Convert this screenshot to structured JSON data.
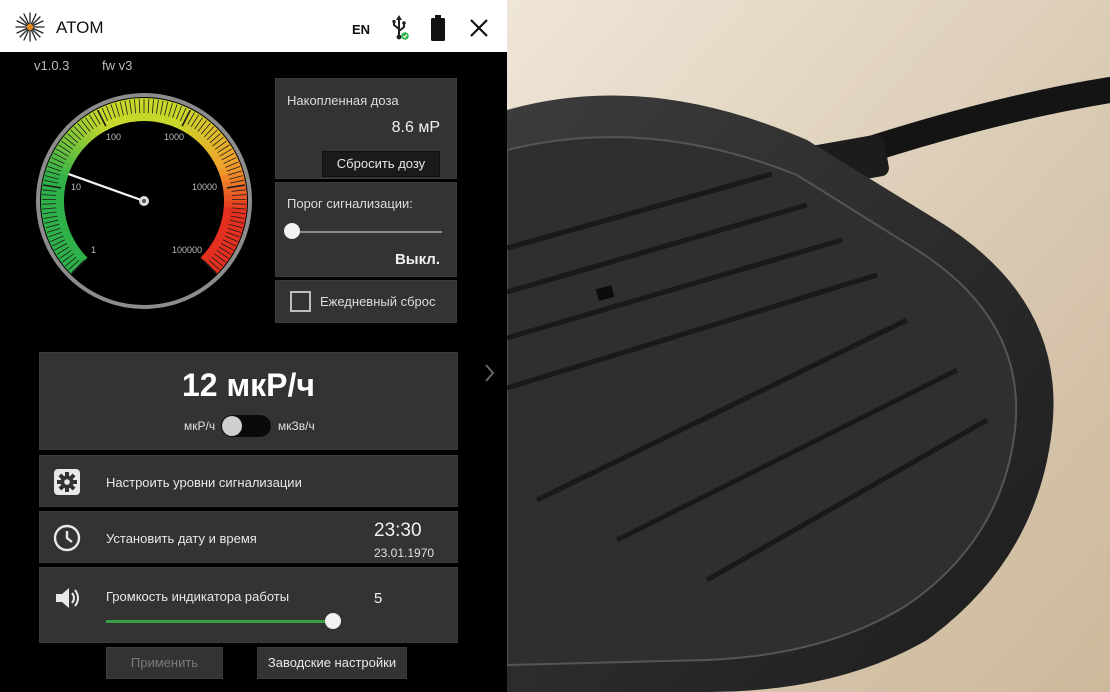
{
  "app": {
    "title": "ATOM",
    "language": "EN",
    "version": "v1.0.3",
    "firmware": "fw v3"
  },
  "icons": {
    "logo": "atom-logo-icon",
    "usb": "usb-connected-icon",
    "battery": "battery-icon",
    "close": "close-icon",
    "settings": "gear-icon",
    "clock": "clock-icon",
    "volume": "speaker-icon",
    "next": "chevron-right-icon"
  },
  "gauge": {
    "labels": [
      "1",
      "10",
      "100",
      "1000",
      "10000",
      "100000"
    ],
    "needle_value": 12,
    "colors": {
      "low": "#2fb14a",
      "mid": "#c8d82a",
      "warn": "#f2a12c",
      "high": "#e53020"
    }
  },
  "dose": {
    "label": "Накопленная доза",
    "value": "8.6 мР",
    "reset_button": "Сбросить дозу"
  },
  "alarm_threshold": {
    "label": "Порог сигнализации:",
    "value": "Выкл.",
    "level": 0
  },
  "daily_reset": {
    "label": "Ежедневный сброс",
    "checked": false
  },
  "rate": {
    "value": "12 мкР/ч",
    "unit_left": "мкР/ч",
    "unit_right": "мкЗв/ч",
    "toggle_on": false
  },
  "settings": {
    "alarm_levels_label": "Настроить уровни сигнализации",
    "datetime_label": "Установить дату и время",
    "time": "23:30",
    "date": "23.01.1970",
    "volume_label": "Громкость индикатора работы",
    "volume_value": "5",
    "volume_level": 1.0
  },
  "buttons": {
    "apply": "Применить",
    "factory": "Заводские настройки"
  },
  "colors": {
    "accent_green": "#39a144",
    "panel": "#333333",
    "background": "#000000"
  }
}
